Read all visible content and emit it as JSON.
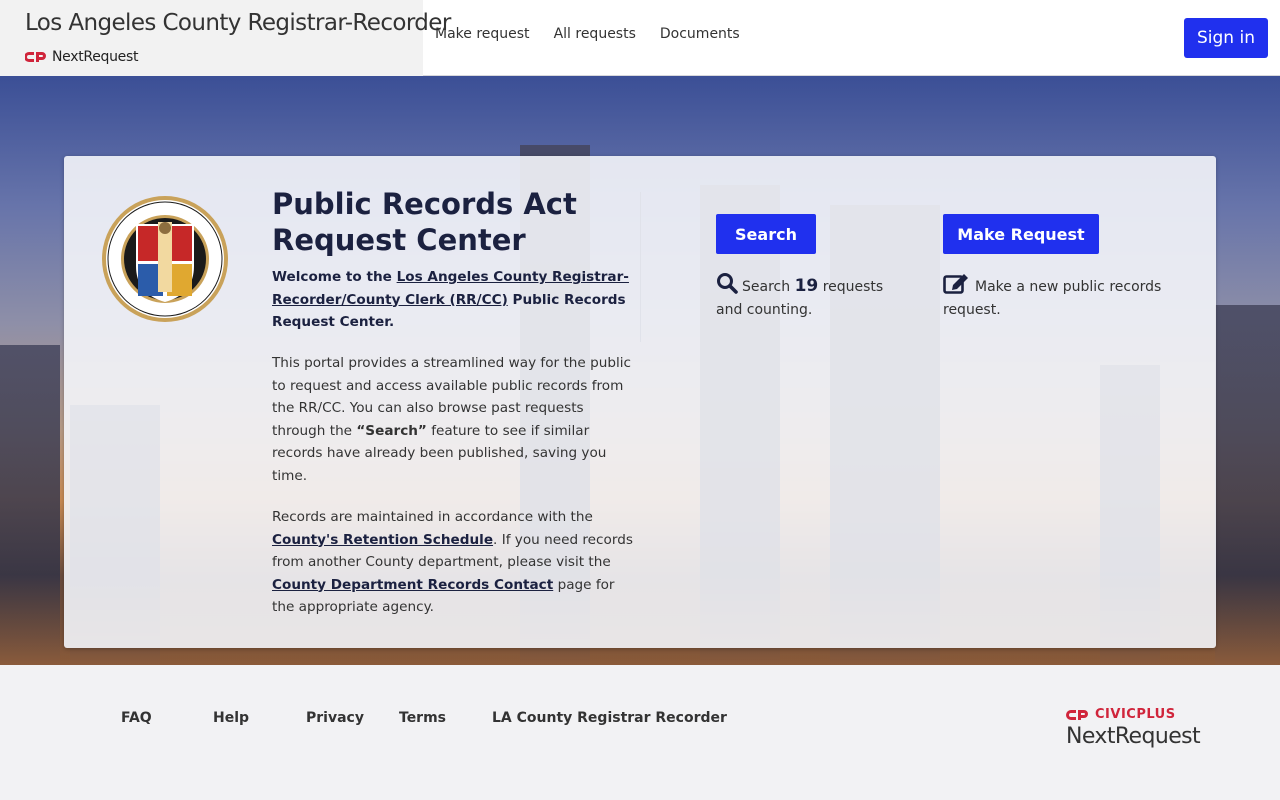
{
  "header": {
    "org_title": "Los Angeles County Registrar-Recorder",
    "brand_name": "NextRequest",
    "nav": [
      "Make request",
      "All requests",
      "Documents"
    ],
    "signin_label": "Sign in"
  },
  "main": {
    "heading": "Public Records Act Request Center",
    "intro_welcome": "Welcome to the",
    "intro_link": "Los Angeles County Registrar-Recorder/County Clerk (RR/CC)",
    "intro_rest": "Public Records Request Center.",
    "para1_text1": "This portal provides a streamlined way for the public to request and access available public records from the RR/CC. You can also browse past requests through the",
    "para1_search": "“Search”",
    "para1_text2": "feature to see if similar records have already been published, saving you time.",
    "para2_text1": "Records are maintained in accordance with the",
    "para2_link1": "County's Retention Schedule",
    "para2_text2": ". If you need records from another County department, please visit the",
    "para2_link2": "County Department Records Contact",
    "para2_text3": "page for the appropriate agency.",
    "search_button": "Search",
    "search_desc_prefix": "Search",
    "search_count": "19",
    "search_desc_suffix": "requests and counting.",
    "make_button": "Make Request",
    "make_desc": "Make a new public records request."
  },
  "footer": {
    "links": [
      "FAQ",
      "Help",
      "Privacy",
      "Terms",
      "LA County Registrar Recorder"
    ],
    "civicplus": "CIVICPLUS",
    "nextrequest": "NextRequest"
  },
  "colors": {
    "primary_button": "#2030ee",
    "heading": "#1b2140",
    "civicplus_red": "#d0253b"
  }
}
